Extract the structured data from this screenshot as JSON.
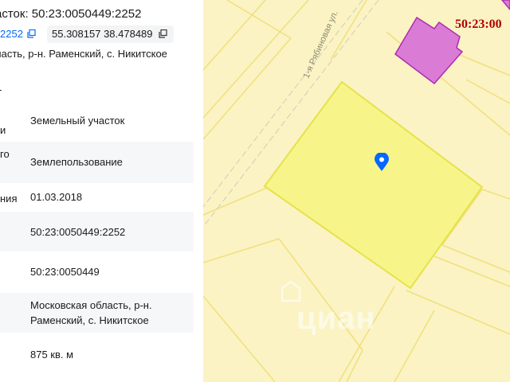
{
  "header": {
    "title": "асток: 50:23:0050449:2252",
    "cad_chip": "2252",
    "coords_chip": "55.308157 38.478489",
    "address": "ласть, р-н. Раменский, с. Никитское",
    "dash": "-"
  },
  "details": [
    {
      "label": "и",
      "value": "Земельный участок"
    },
    {
      "label": "го",
      "value": "Землепользование"
    },
    {
      "label": "ния",
      "value": "01.03.2018"
    },
    {
      "label": "",
      "value": "50:23:0050449:2252"
    },
    {
      "label": "",
      "value": "50:23:0050449"
    },
    {
      "label": "",
      "value": "Московская область, р-н. Раменский, с. Никитское"
    },
    {
      "label": "",
      "value": "875 кв. м"
    }
  ],
  "map": {
    "cadastral_label": "50:23:00",
    "street_label": "1-я Рябиновая ул.",
    "watermark": "циан",
    "colors": {
      "background": "#fbf3c4",
      "parcel_fill": "#f7f58a",
      "parcel_stroke": "#e6e24a",
      "building_fill": "#da7bd6",
      "building_stroke": "#b02bb0",
      "label_color": "#b30000",
      "pin_color": "#0468ff"
    },
    "icons": [
      "location-pin-icon",
      "cian-logo-icon"
    ]
  },
  "icons": [
    "copy-icon"
  ]
}
